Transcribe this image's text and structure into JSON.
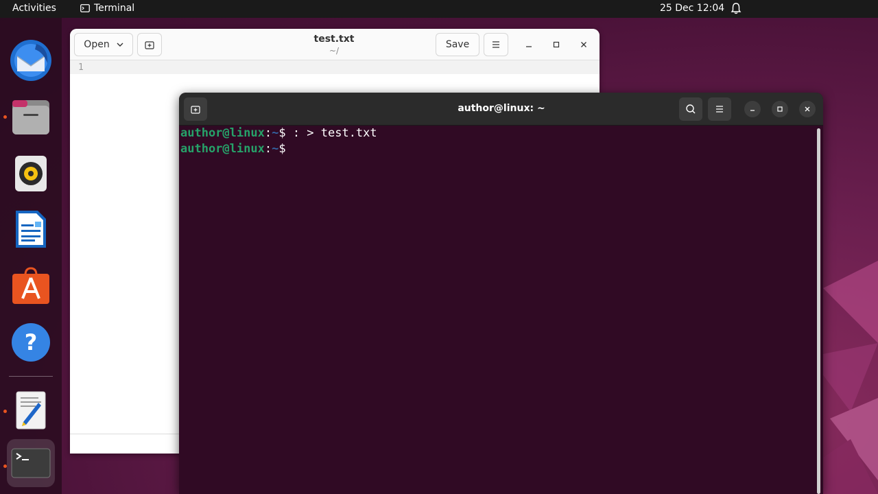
{
  "topbar": {
    "activities": "Activities",
    "app_name": "Terminal",
    "app_icon": "terminal-icon",
    "clock": "25 Dec  12:04",
    "notification_icon": "bell-icon"
  },
  "dock": {
    "items": [
      {
        "name": "thunderbird",
        "icon": "mail-icon",
        "running": false
      },
      {
        "name": "files",
        "icon": "folder-icon",
        "running": true
      },
      {
        "name": "rhythmbox",
        "icon": "speaker-icon",
        "running": false
      },
      {
        "name": "libreoffice-writer",
        "icon": "document-icon",
        "running": false
      },
      {
        "name": "app-center",
        "icon": "store-icon",
        "running": false
      },
      {
        "name": "help",
        "icon": "help-icon",
        "running": false
      },
      {
        "name": "text-editor",
        "icon": "text-editor-icon",
        "running": true
      },
      {
        "name": "terminal",
        "icon": "terminal-icon",
        "running": true
      }
    ]
  },
  "gedit": {
    "open_label": "Open",
    "title": "test.txt",
    "subtitle": "~/",
    "save_label": "Save",
    "line_number": "1"
  },
  "terminal": {
    "title": "author@linux: ~",
    "lines": [
      {
        "user": "author@linux",
        "sep": ":",
        "path": "~",
        "prompt": "$ ",
        "command": ": > test.txt"
      },
      {
        "user": "author@linux",
        "sep": ":",
        "path": "~",
        "prompt": "$ ",
        "command": ""
      }
    ]
  },
  "colors": {
    "terminal_bg": "#300a24",
    "prompt_user": "#26a269",
    "prompt_path": "#3465a4",
    "accent": "#e95420"
  }
}
